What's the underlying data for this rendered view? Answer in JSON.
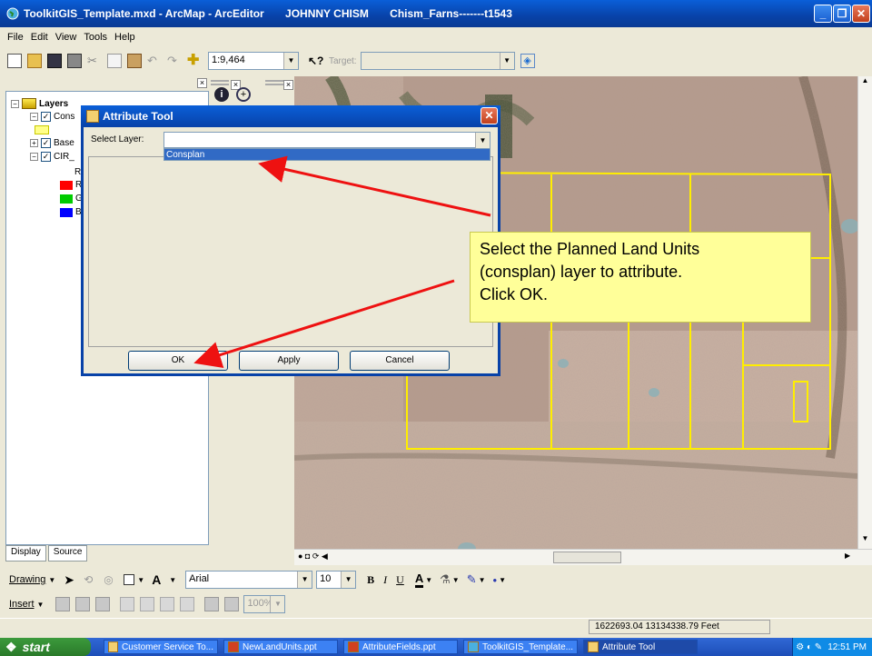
{
  "window": {
    "title": "ToolkitGIS_Template.mxd - ArcMap - ArcEditor       JOHNNY CHISM       Chism_Farns-------t1543"
  },
  "menu": [
    "File",
    "Edit",
    "View",
    "Tools",
    "Help"
  ],
  "standard_toolbar": {
    "scale": "1:9,464",
    "target_label": "Target:"
  },
  "toc": {
    "root": "Layers",
    "layers": [
      {
        "label": "Cons",
        "checked": true
      },
      {
        "label": "Base",
        "checked": true
      },
      {
        "label": "CIR_",
        "checked": true
      }
    ],
    "band_letters": [
      "R",
      "R",
      "G",
      "B"
    ],
    "colors": {
      "red": "#ff0000",
      "green": "#00cc00",
      "blue": "#0000ff",
      "yellow": "#ffff88"
    }
  },
  "tabs": {
    "display": "Display",
    "source": "Source"
  },
  "drawing_toolbar": {
    "drawing_label": "Drawing",
    "font": "Arial",
    "font_size": "10",
    "bold": "B",
    "italic": "I",
    "underline": "U"
  },
  "insert_toolbar": {
    "insert_label": "Insert",
    "zoom": "100%"
  },
  "status": {
    "coords": "1622693.04  13134338.79 Feet"
  },
  "taskbar": {
    "start": "start",
    "tasks": [
      "Customer Service To...",
      "NewLandUnits.ppt",
      "AttributeFields.ppt",
      "ToolkitGIS_Template...",
      "Attribute Tool"
    ],
    "clock": "12:51 PM"
  },
  "dialog": {
    "title": "Attribute Tool",
    "select_layer_label": "Select Layer:",
    "selected_value": "",
    "option": "Consplan",
    "ok": "OK",
    "apply": "Apply",
    "cancel": "Cancel"
  },
  "callout": {
    "line1": "Select the Planned Land Units",
    "line2": "(consplan) layer to attribute.",
    "line3": "Click OK."
  },
  "accent": {
    "arrow": "#ee1111",
    "parcel_lines": "#ffee00",
    "xp_blue": "#0842a8"
  }
}
